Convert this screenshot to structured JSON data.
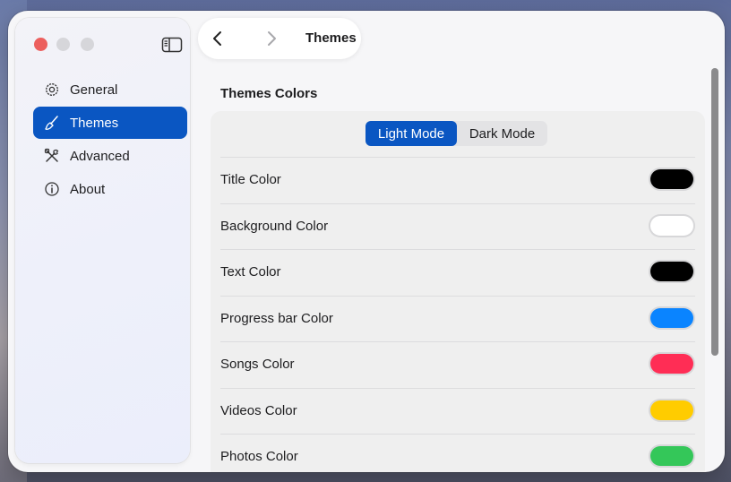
{
  "window": {
    "title": "Themes"
  },
  "sidebar": {
    "items": [
      {
        "label": "General",
        "icon": "gear-icon",
        "active": false
      },
      {
        "label": "Themes",
        "icon": "paintbrush-icon",
        "active": true
      },
      {
        "label": "Advanced",
        "icon": "tools-icon",
        "active": false
      },
      {
        "label": "About",
        "icon": "info-icon",
        "active": false
      }
    ]
  },
  "toolbar": {
    "title": "Themes"
  },
  "content": {
    "section_title": "Themes Colors",
    "segments": [
      "Light Mode",
      "Dark Mode"
    ],
    "selected_segment": "Light Mode",
    "rows": [
      {
        "label": "Title Color",
        "color": "#000000"
      },
      {
        "label": "Background Color",
        "color": "#ffffff"
      },
      {
        "label": "Text Color",
        "color": "#000000"
      },
      {
        "label": "Progress bar Color",
        "color": "#0a84ff"
      },
      {
        "label": "Songs Color",
        "color": "#ff2d55"
      },
      {
        "label": "Videos Color",
        "color": "#ffcc00"
      },
      {
        "label": "Photos Color",
        "color": "#34c759"
      }
    ]
  },
  "colors": {
    "accent": "#0a56c2",
    "close": "#ec5f5d",
    "inactive_light": "#d6d6da"
  }
}
